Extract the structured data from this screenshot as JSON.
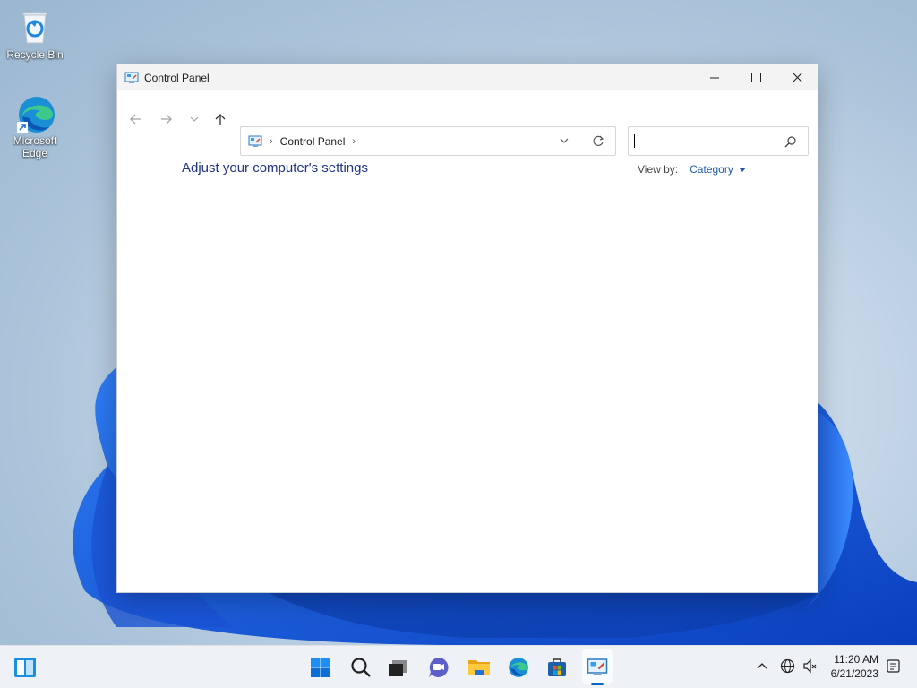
{
  "desktop": {
    "icons": [
      {
        "label": "Recycle Bin",
        "icon": "recycle-bin-icon"
      },
      {
        "label": "Microsoft Edge",
        "icon": "edge-icon"
      }
    ]
  },
  "window": {
    "title": "Control Panel",
    "app_icon": "control-panel-icon",
    "controls": {
      "minimize": "minimize-icon",
      "maximize": "maximize-icon",
      "close": "close-icon"
    },
    "nav": {
      "back": "arrow-left-icon",
      "forward": "arrow-right-icon",
      "recent": "chevron-down-icon",
      "up": "arrow-up-icon"
    },
    "address": {
      "crumbs": [
        "Control Panel"
      ],
      "dropdown_icon": "chevron-down-icon",
      "refresh_icon": "refresh-icon"
    },
    "search": {
      "value": "",
      "placeholder": "",
      "icon": "search-icon"
    },
    "heading": "Adjust your computer's settings",
    "view_by": {
      "label": "View by:",
      "value": "Category"
    }
  },
  "taskbar": {
    "widgets_icon": "widgets-icon",
    "apps": [
      {
        "name": "Start",
        "icon": "windows-start-icon"
      },
      {
        "name": "Search",
        "icon": "search-icon"
      },
      {
        "name": "Task View",
        "icon": "task-view-icon"
      },
      {
        "name": "Chat",
        "icon": "chat-icon"
      },
      {
        "name": "File Explorer",
        "icon": "folder-icon"
      },
      {
        "name": "Microsoft Edge",
        "icon": "edge-icon"
      },
      {
        "name": "Microsoft Store",
        "icon": "store-icon"
      },
      {
        "name": "Control Panel",
        "icon": "control-panel-icon",
        "active": true
      }
    ],
    "tray": {
      "overflow_icon": "chevron-up-icon",
      "network_icon": "globe-icon",
      "volume_icon": "speaker-muted-icon",
      "notification_icon": "notification-icon"
    },
    "clock": {
      "time": "11:20 AM",
      "date": "6/21/2023"
    }
  },
  "colors": {
    "accent": "#0067c0",
    "heading": "#1e3287",
    "link": "#1e5aa8"
  }
}
